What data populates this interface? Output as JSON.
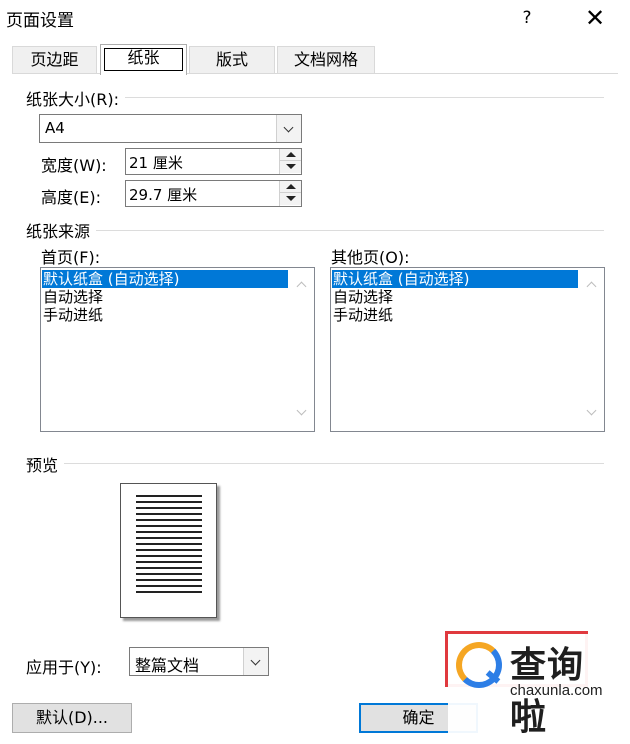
{
  "window": {
    "title": "页面设置",
    "help_glyph": "?",
    "close_glyph": "✕"
  },
  "tabs": [
    {
      "label": "页边距"
    },
    {
      "label": "纸张",
      "active": true
    },
    {
      "label": "版式"
    },
    {
      "label": "文档网格"
    }
  ],
  "paper_size": {
    "group_label": "纸张大小(R):",
    "selected": "A4",
    "width_label": "宽度(W):",
    "width_value": "21 厘米",
    "height_label": "高度(E):",
    "height_value": "29.7 厘米"
  },
  "paper_source": {
    "group_label": "纸张来源",
    "first_page_label": "首页(F):",
    "other_pages_label": "其他页(O):",
    "options": [
      "默认纸盒 (自动选择)",
      "自动选择",
      "手动进纸"
    ],
    "first_page_selected": "默认纸盒 (自动选择)",
    "other_pages_selected": "默认纸盒 (自动选择)"
  },
  "preview": {
    "group_label": "预览"
  },
  "apply_to": {
    "label": "应用于(Y):",
    "selected": "整篇文档"
  },
  "buttons": {
    "default_label": "默认(D)...",
    "ok_label": "确定"
  },
  "watermark": {
    "name": "查询啦",
    "url": "chaxunla.com"
  },
  "colors": {
    "selection": "#0078d7",
    "highlight_box": "#e0393e",
    "watermark_orange": "#f5a623",
    "watermark_blue": "#2d7ee6"
  }
}
